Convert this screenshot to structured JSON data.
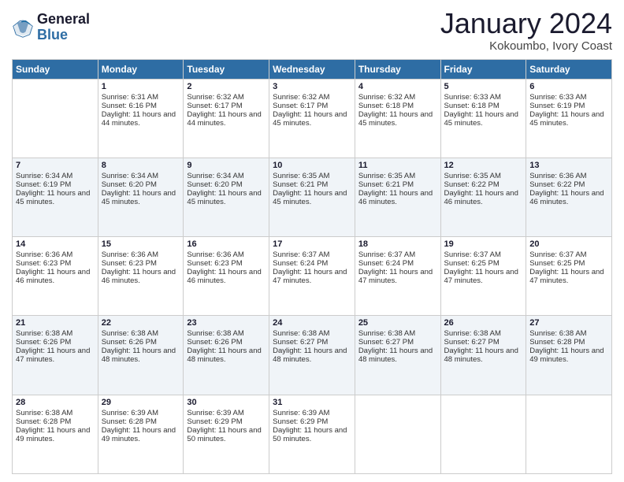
{
  "header": {
    "logo": {
      "general": "General",
      "blue": "Blue"
    },
    "title": "January 2024",
    "subtitle": "Kokoumbo, Ivory Coast"
  },
  "weekdays": [
    "Sunday",
    "Monday",
    "Tuesday",
    "Wednesday",
    "Thursday",
    "Friday",
    "Saturday"
  ],
  "weeks": [
    [
      {
        "day": "",
        "sunrise": "",
        "sunset": "",
        "daylight": ""
      },
      {
        "day": "1",
        "sunrise": "Sunrise: 6:31 AM",
        "sunset": "Sunset: 6:16 PM",
        "daylight": "Daylight: 11 hours and 44 minutes."
      },
      {
        "day": "2",
        "sunrise": "Sunrise: 6:32 AM",
        "sunset": "Sunset: 6:17 PM",
        "daylight": "Daylight: 11 hours and 44 minutes."
      },
      {
        "day": "3",
        "sunrise": "Sunrise: 6:32 AM",
        "sunset": "Sunset: 6:17 PM",
        "daylight": "Daylight: 11 hours and 45 minutes."
      },
      {
        "day": "4",
        "sunrise": "Sunrise: 6:32 AM",
        "sunset": "Sunset: 6:18 PM",
        "daylight": "Daylight: 11 hours and 45 minutes."
      },
      {
        "day": "5",
        "sunrise": "Sunrise: 6:33 AM",
        "sunset": "Sunset: 6:18 PM",
        "daylight": "Daylight: 11 hours and 45 minutes."
      },
      {
        "day": "6",
        "sunrise": "Sunrise: 6:33 AM",
        "sunset": "Sunset: 6:19 PM",
        "daylight": "Daylight: 11 hours and 45 minutes."
      }
    ],
    [
      {
        "day": "7",
        "sunrise": "Sunrise: 6:34 AM",
        "sunset": "Sunset: 6:19 PM",
        "daylight": "Daylight: 11 hours and 45 minutes."
      },
      {
        "day": "8",
        "sunrise": "Sunrise: 6:34 AM",
        "sunset": "Sunset: 6:20 PM",
        "daylight": "Daylight: 11 hours and 45 minutes."
      },
      {
        "day": "9",
        "sunrise": "Sunrise: 6:34 AM",
        "sunset": "Sunset: 6:20 PM",
        "daylight": "Daylight: 11 hours and 45 minutes."
      },
      {
        "day": "10",
        "sunrise": "Sunrise: 6:35 AM",
        "sunset": "Sunset: 6:21 PM",
        "daylight": "Daylight: 11 hours and 45 minutes."
      },
      {
        "day": "11",
        "sunrise": "Sunrise: 6:35 AM",
        "sunset": "Sunset: 6:21 PM",
        "daylight": "Daylight: 11 hours and 46 minutes."
      },
      {
        "day": "12",
        "sunrise": "Sunrise: 6:35 AM",
        "sunset": "Sunset: 6:22 PM",
        "daylight": "Daylight: 11 hours and 46 minutes."
      },
      {
        "day": "13",
        "sunrise": "Sunrise: 6:36 AM",
        "sunset": "Sunset: 6:22 PM",
        "daylight": "Daylight: 11 hours and 46 minutes."
      }
    ],
    [
      {
        "day": "14",
        "sunrise": "Sunrise: 6:36 AM",
        "sunset": "Sunset: 6:23 PM",
        "daylight": "Daylight: 11 hours and 46 minutes."
      },
      {
        "day": "15",
        "sunrise": "Sunrise: 6:36 AM",
        "sunset": "Sunset: 6:23 PM",
        "daylight": "Daylight: 11 hours and 46 minutes."
      },
      {
        "day": "16",
        "sunrise": "Sunrise: 6:36 AM",
        "sunset": "Sunset: 6:23 PM",
        "daylight": "Daylight: 11 hours and 46 minutes."
      },
      {
        "day": "17",
        "sunrise": "Sunrise: 6:37 AM",
        "sunset": "Sunset: 6:24 PM",
        "daylight": "Daylight: 11 hours and 47 minutes."
      },
      {
        "day": "18",
        "sunrise": "Sunrise: 6:37 AM",
        "sunset": "Sunset: 6:24 PM",
        "daylight": "Daylight: 11 hours and 47 minutes."
      },
      {
        "day": "19",
        "sunrise": "Sunrise: 6:37 AM",
        "sunset": "Sunset: 6:25 PM",
        "daylight": "Daylight: 11 hours and 47 minutes."
      },
      {
        "day": "20",
        "sunrise": "Sunrise: 6:37 AM",
        "sunset": "Sunset: 6:25 PM",
        "daylight": "Daylight: 11 hours and 47 minutes."
      }
    ],
    [
      {
        "day": "21",
        "sunrise": "Sunrise: 6:38 AM",
        "sunset": "Sunset: 6:26 PM",
        "daylight": "Daylight: 11 hours and 47 minutes."
      },
      {
        "day": "22",
        "sunrise": "Sunrise: 6:38 AM",
        "sunset": "Sunset: 6:26 PM",
        "daylight": "Daylight: 11 hours and 48 minutes."
      },
      {
        "day": "23",
        "sunrise": "Sunrise: 6:38 AM",
        "sunset": "Sunset: 6:26 PM",
        "daylight": "Daylight: 11 hours and 48 minutes."
      },
      {
        "day": "24",
        "sunrise": "Sunrise: 6:38 AM",
        "sunset": "Sunset: 6:27 PM",
        "daylight": "Daylight: 11 hours and 48 minutes."
      },
      {
        "day": "25",
        "sunrise": "Sunrise: 6:38 AM",
        "sunset": "Sunset: 6:27 PM",
        "daylight": "Daylight: 11 hours and 48 minutes."
      },
      {
        "day": "26",
        "sunrise": "Sunrise: 6:38 AM",
        "sunset": "Sunset: 6:27 PM",
        "daylight": "Daylight: 11 hours and 48 minutes."
      },
      {
        "day": "27",
        "sunrise": "Sunrise: 6:38 AM",
        "sunset": "Sunset: 6:28 PM",
        "daylight": "Daylight: 11 hours and 49 minutes."
      }
    ],
    [
      {
        "day": "28",
        "sunrise": "Sunrise: 6:38 AM",
        "sunset": "Sunset: 6:28 PM",
        "daylight": "Daylight: 11 hours and 49 minutes."
      },
      {
        "day": "29",
        "sunrise": "Sunrise: 6:39 AM",
        "sunset": "Sunset: 6:28 PM",
        "daylight": "Daylight: 11 hours and 49 minutes."
      },
      {
        "day": "30",
        "sunrise": "Sunrise: 6:39 AM",
        "sunset": "Sunset: 6:29 PM",
        "daylight": "Daylight: 11 hours and 50 minutes."
      },
      {
        "day": "31",
        "sunrise": "Sunrise: 6:39 AM",
        "sunset": "Sunset: 6:29 PM",
        "daylight": "Daylight: 11 hours and 50 minutes."
      },
      {
        "day": "",
        "sunrise": "",
        "sunset": "",
        "daylight": ""
      },
      {
        "day": "",
        "sunrise": "",
        "sunset": "",
        "daylight": ""
      },
      {
        "day": "",
        "sunrise": "",
        "sunset": "",
        "daylight": ""
      }
    ]
  ]
}
